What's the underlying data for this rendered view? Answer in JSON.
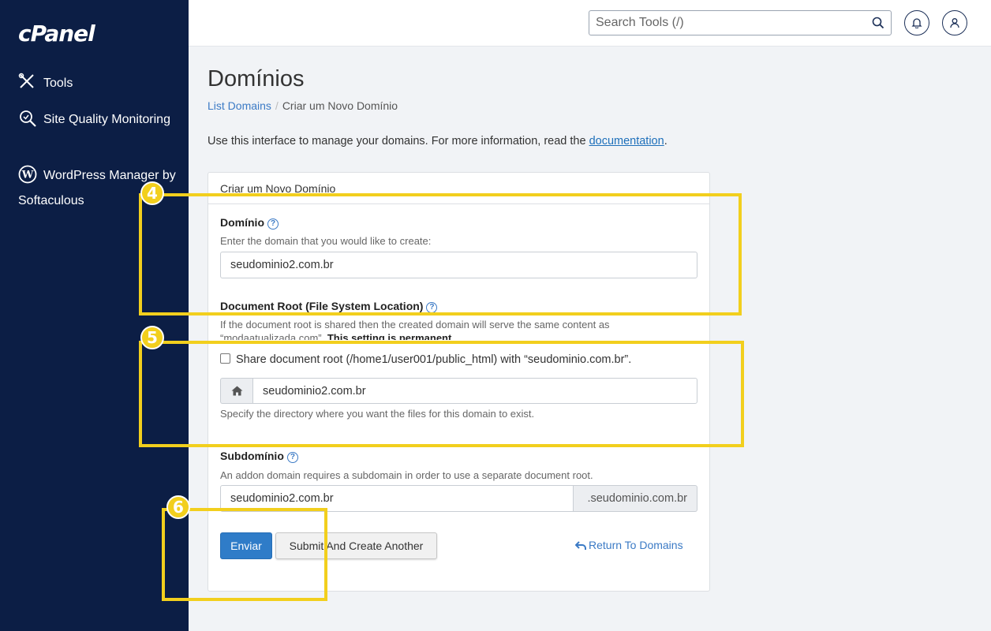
{
  "sidebar": {
    "logo": "cPanel",
    "items": [
      {
        "label": "Tools",
        "icon": "tools-icon"
      },
      {
        "label": "Site Quality Monitoring",
        "icon": "magnifier-icon"
      },
      {
        "label": "WordPress Manager by Softaculous",
        "icon": "wordpress-icon"
      }
    ]
  },
  "header": {
    "search_placeholder": "Search Tools (/)"
  },
  "page": {
    "title": "Domínios",
    "breadcrumb": [
      "List Domains",
      "Criar um Novo Domínio"
    ],
    "intro_text": "Use this interface to manage your domains. For more information, read the ",
    "intro_link": "documentation",
    "intro_end": "."
  },
  "form": {
    "panel_title": "Criar um Novo Domínio",
    "domain_label": "Domínio",
    "domain_hint": "Enter the domain that you would like to create:",
    "domain_value": "seudominio2.com.br",
    "docroot_label": "Document Root (File System Location)",
    "docroot_hint_1": "If the document root is shared then the created domain will serve the same content as",
    "docroot_hint_2": "“modaatualizada.com”. ",
    "docroot_hint_bold": "This setting is permanent.",
    "share_checkbox_label": "Share document root (/home1/user001/public_html) with “seudominio.com.br”.",
    "docroot_value": "seudominio2.com.br",
    "docroot_help": "Specify the directory where you want the files for this domain to exist.",
    "subdomain_label": "Subdomínio",
    "subdomain_hint": "An addon domain requires a subdomain in order to use a separate document root.",
    "subdomain_value": "seudominio2.com.br",
    "subdomain_suffix": ".seudominio.com.br",
    "submit_label": "Enviar",
    "submit_another_label": "Submit And Create Another",
    "return_label": "Return To Domains"
  },
  "annotations": [
    "4",
    "5",
    "6"
  ],
  "colors": {
    "highlight": "#f2cf1d",
    "sidebar": "#0c1e45",
    "primary": "#2f7cc8"
  }
}
